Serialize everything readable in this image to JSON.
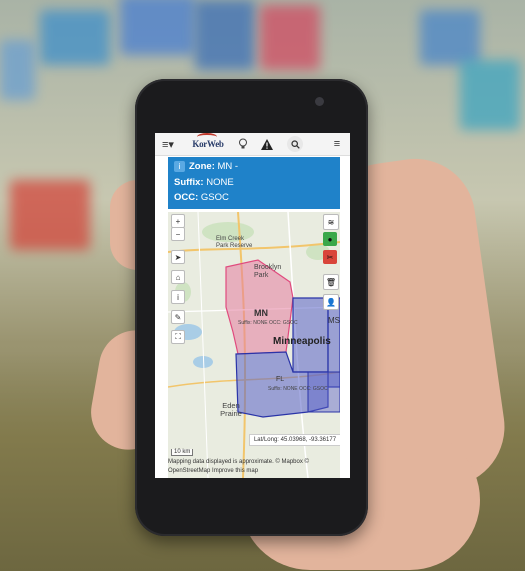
{
  "topnav": {
    "menu_icon": "menu-icon",
    "logo_text": "KorWeb",
    "bulb_icon": "lightbulb-icon",
    "alert_icon": "warning-icon",
    "search_icon": "search-icon",
    "hamburger_icon": "hamburger-icon"
  },
  "info": {
    "zone_label": "Zone:",
    "zone_value": "MN -",
    "suffix_label": "Suffix:",
    "suffix_value": "NONE",
    "occ_label": "OCC:",
    "occ_value": "GSOC"
  },
  "map": {
    "zoom_in": "+",
    "zoom_out": "−",
    "labels": {
      "elm_creek": "Elm Creek Park Reserve",
      "brooklyn_park": "Brooklyn Park",
      "minneapolis": "Minneapolis",
      "eden_prairie": "Eden Prairie",
      "zone_mn": "MN",
      "zone_mn_sub": "Suffix: NONE OCC: GSOC",
      "zone_ms": "MS",
      "zone_fl": "FL",
      "zone_fl_sub": "Suffix: NONE OCC: GSOC"
    },
    "latlong": "Lat/Long: 45.03968, -93.36177",
    "scale": "10 km",
    "attribution_line1": "Mapping data displayed is approximate. © Mapbox ©",
    "attribution_line2": "OpenStreetMap Improve this map"
  },
  "colors": {
    "info_bg": "#1f82c9",
    "zone_pink": "#e67ea0",
    "zone_blue": "#5a62c8",
    "green_btn": "#3aa84a",
    "red_btn": "#d9453a"
  }
}
